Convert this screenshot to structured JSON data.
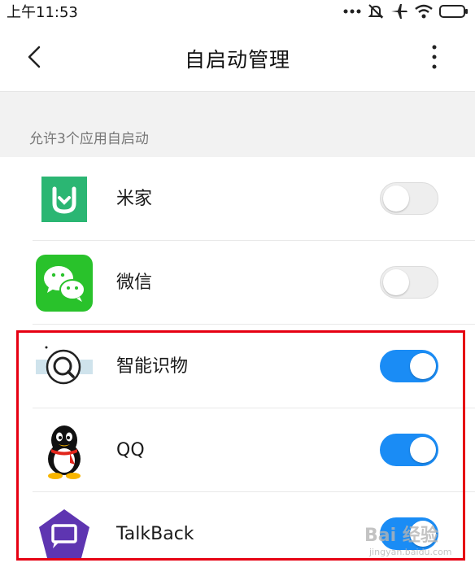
{
  "status_bar": {
    "time": "上午11:53",
    "icons": [
      "more-dots-icon",
      "mute-icon",
      "airplane-icon",
      "wifi-icon",
      "battery-icon"
    ]
  },
  "header": {
    "title": "自启动管理",
    "back_icon": "back-chevron-icon",
    "more_icon": "more-vertical-icon"
  },
  "section": {
    "label": "允许3个应用自启动"
  },
  "apps": [
    {
      "name": "米家",
      "icon": "mijia-icon",
      "enabled": false
    },
    {
      "name": "微信",
      "icon": "wechat-icon",
      "enabled": false
    },
    {
      "name": "智能识物",
      "icon": "smart-recognition-icon",
      "enabled": true
    },
    {
      "name": "QQ",
      "icon": "qq-icon",
      "enabled": true
    },
    {
      "name": "TalkBack",
      "icon": "talkback-icon",
      "enabled": true
    }
  ],
  "colors": {
    "toggle_on": "#1a8cf5",
    "toggle_off": "#eeeeee",
    "highlight": "#e60012",
    "mijia": "#2bb673",
    "wechat": "#29c22b",
    "talkback": "#5e35b1"
  },
  "watermark": {
    "logo": "Bai 经验",
    "url": "jingyan.baidu.com"
  }
}
